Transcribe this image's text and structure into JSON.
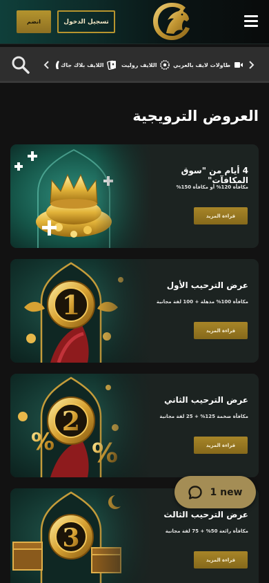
{
  "header": {
    "join_label": "انضم",
    "login_label": "تسجيل الدخول",
    "logo_icon": "horse-head-logo",
    "menu_icon": "hamburger-menu-icon",
    "accent_color": "#b8952e"
  },
  "categories": {
    "search_icon": "search-icon",
    "items": [
      {
        "label": "طاولات لايف بالعربي",
        "icon": "video-camera-icon"
      },
      {
        "label": "اللايف روليت",
        "icon": "roulette-wheel-icon"
      },
      {
        "label": "اللايف بلاك جاك",
        "icon": "playing-cards-icon"
      },
      {
        "label": "",
        "icon": "partial-category-icon"
      }
    ]
  },
  "promotions": {
    "title": "العروض الترويجية",
    "button_label": "قراءة المزيد",
    "cards": [
      {
        "title": "4 أيام من \"سوق المكافآت\"",
        "desc": "مكافأة 120% أو مكافأة 150%",
        "art": "gold-crown-coins"
      },
      {
        "title": "عرض الترحيب الأول",
        "desc": "مكافأة 100% مذهلة + 100 لفة مجانية",
        "art": "gold-coin-number-1"
      },
      {
        "title": "عرض الترحيب الثاني",
        "desc": "مكافأة ضخمة 125% + 25 لفة مجانية",
        "art": "gold-coin-number-2"
      },
      {
        "title": "عرض الترحيب الثالث",
        "desc": "مكافأة رائعة 50% + 75 لفة مجانية",
        "art": "gold-coin-number-3"
      }
    ]
  },
  "chat": {
    "label": "1 new",
    "icon": "chat-bubble-icon"
  }
}
